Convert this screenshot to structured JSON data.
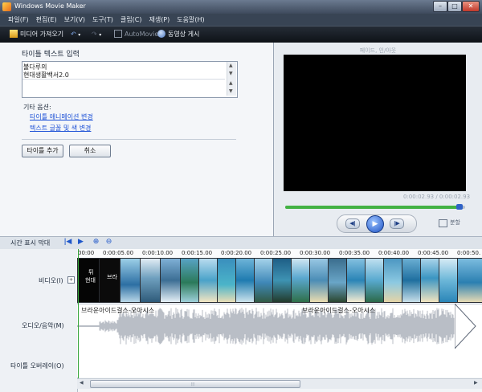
{
  "window": {
    "title": "Windows Movie Maker",
    "min": "–",
    "max": "□",
    "close": "✕"
  },
  "menu": [
    "파일(F)",
    "편집(E)",
    "보기(V)",
    "도구(T)",
    "클립(C)",
    "재생(P)",
    "도움말(H)"
  ],
  "toolbar": {
    "import": "미디어 가져오기",
    "automovie": "AutoMovie",
    "publish": "동영상 게시"
  },
  "task": {
    "heading": "타이틀 텍스트 입력",
    "text_lines": [
      "불다루의",
      "현대생활백서2.0"
    ],
    "other_options": "기타 옵션:",
    "link_animation": "타이틀 애니메이션 변경",
    "link_font": "텍스트 글꼴 및 색 변경",
    "add_button": "타이틀 추가",
    "cancel_button": "취소"
  },
  "preview": {
    "title": "페이드, 인/아웃",
    "time": "0:00:02.93 / 0:00:02.93",
    "progress": 0.97,
    "prev": "◀ǀ",
    "play": "▶",
    "next": "ǀ▶",
    "split": "분할"
  },
  "timeline": {
    "view_label": "시간 표시 막대",
    "prev_icon": "ǀ◀",
    "play_icon": "▶",
    "zoom_in_icon": "⊕",
    "zoom_out_icon": "⊖",
    "ruler": [
      "00:00",
      "0:00:05.00",
      "0:00:10.00",
      "0:00:15.00",
      "0:00:20.00",
      "0:00:25.00",
      "0:00:30.00",
      "0:00:35.00",
      "0:00:40.00",
      "0:00:45.00",
      "0:00:50."
    ],
    "tracks": {
      "video": "비디오(I)",
      "audio": "오디오/음악(M)",
      "overlay": "타이틀 오버레이(O)"
    },
    "expand": "+",
    "title_clip1": [
      "튀",
      "현대"
    ],
    "title_clip2": "브라",
    "audio_clips": [
      "브라운아이드걸스-오아시스",
      "브라운아이드걸스-오아시스"
    ],
    "scroll_grip": "⦙⦙⦙",
    "scroll_left": "◀",
    "scroll_right": "▶"
  },
  "colors": {
    "accent_green": "#43b244",
    "link_blue": "#1a4fd6"
  }
}
